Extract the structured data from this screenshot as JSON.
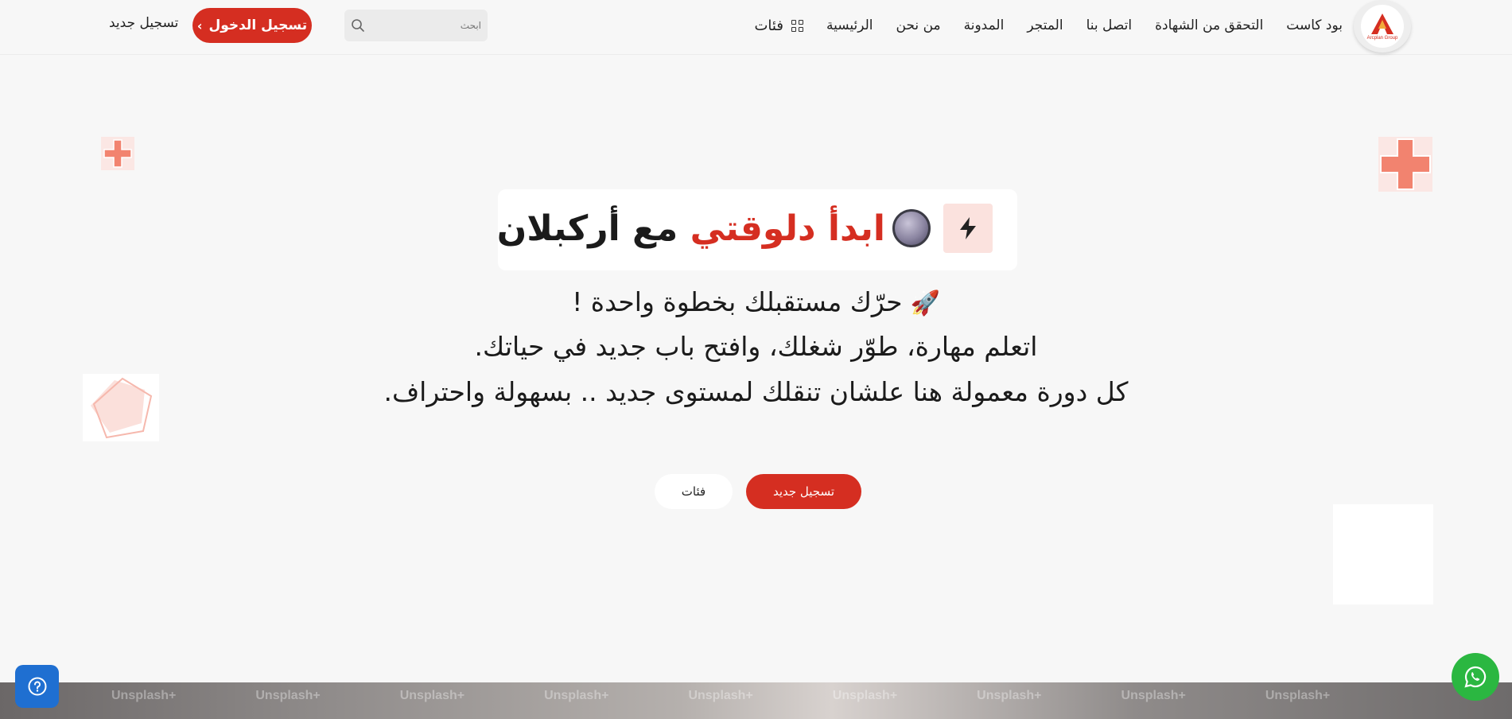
{
  "header": {
    "logo_text": "Arcplan Group",
    "nav": {
      "categories": "فئات",
      "home": "الرئيسية",
      "about": "من نحن",
      "blog": "المدونة",
      "store": "المتجر",
      "contact": "اتصل بنا",
      "certificate": "التحقق من الشهادة",
      "podcast": "بود كاست"
    },
    "search_placeholder": "ابحث",
    "login_label": "تسجيل الدخول",
    "register_label": "تسجيل جديد"
  },
  "hero": {
    "title_accent": "ابدأ دلوقتي",
    "title_rest": " مع أركبلان",
    "line1": "حرّك مستقبلك بخطوة واحدة !",
    "line2": "اتعلم مهارة، طوّر شغلك، وافتح باب جديد في حياتك.",
    "line3": "كل دورة معمولة هنا علشان تنقلك لمستوى جديد .. بسهولة واحتراف.",
    "cta_primary": "تسجيل جديد",
    "cta_secondary": "فئات"
  },
  "strip": {
    "watermarks": [
      "Unsplash+",
      "Unsplash+",
      "Unsplash+",
      "Unsplash+",
      "Unsplash+",
      "Unsplash+",
      "Unsplash+",
      "Unsplash+",
      "Unsplash+"
    ]
  },
  "colors": {
    "accent": "#d52e21",
    "help_blue": "#1f6fd1",
    "whatsapp_green": "#2bb741"
  },
  "icons": {
    "logo": "arcplan-logo",
    "categories": "grid-icon",
    "search": "search-icon",
    "login_chevron": "chevron-left-icon",
    "title_badge": "bolt-icon",
    "title_emoji": "circle-emoji-icon",
    "rocket": "rocket-icon",
    "help": "question-circle-icon",
    "whatsapp": "whatsapp-icon"
  }
}
